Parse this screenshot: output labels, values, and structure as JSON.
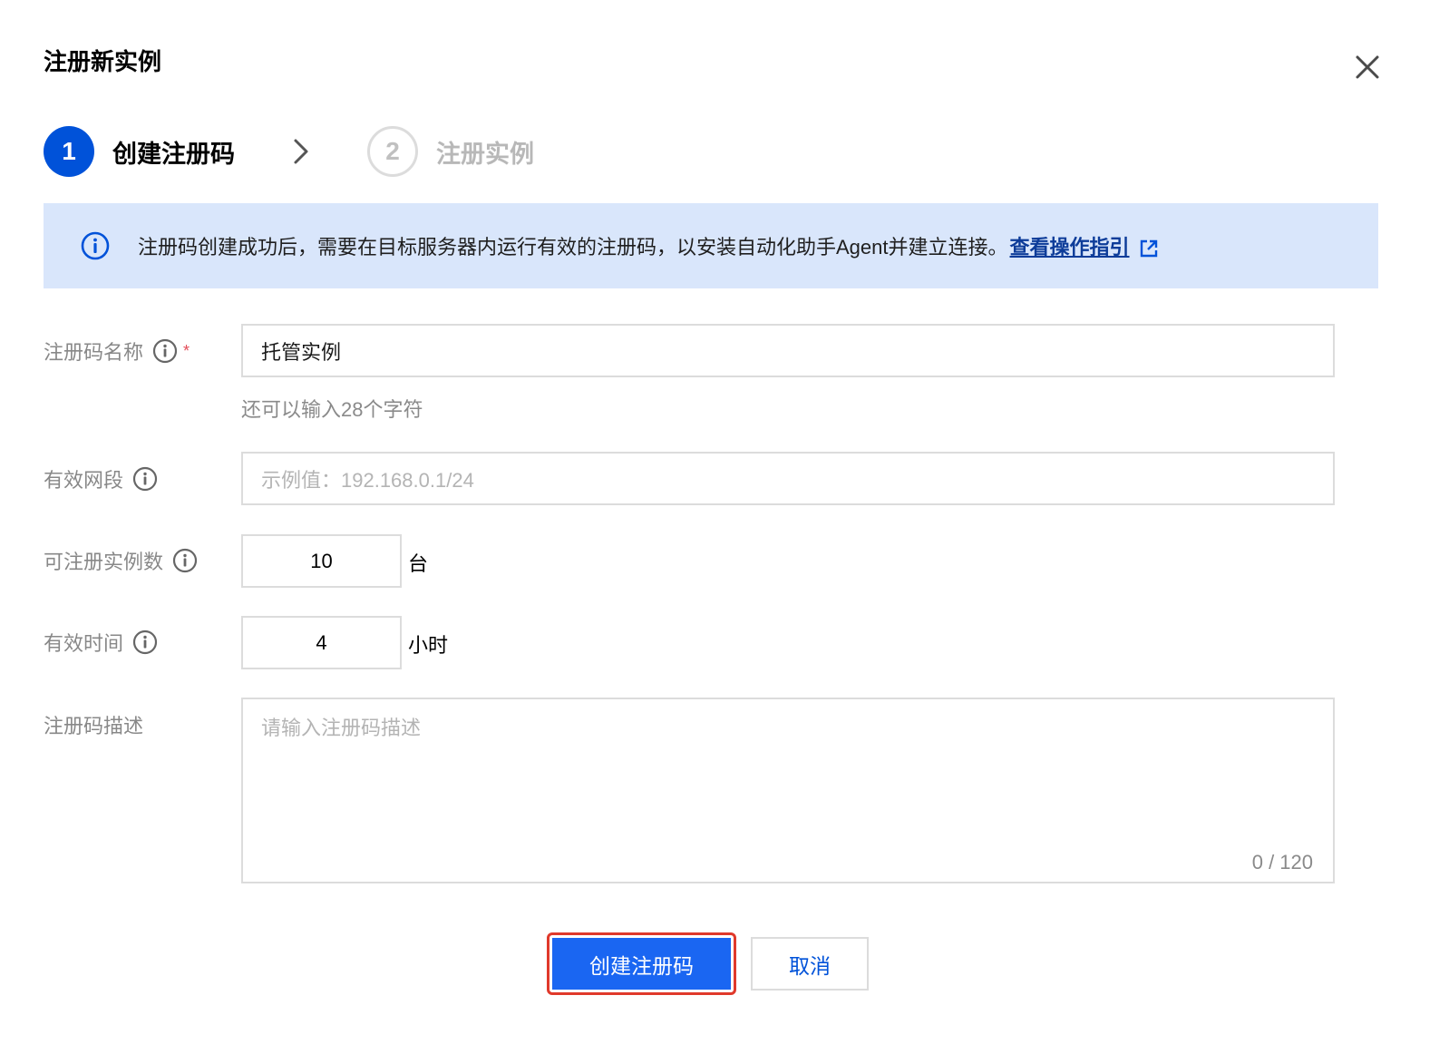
{
  "dialog": {
    "title": "注册新实例"
  },
  "steps": [
    {
      "number": "1",
      "label": "创建注册码",
      "state": "active"
    },
    {
      "number": "2",
      "label": "注册实例",
      "state": "inactive"
    }
  ],
  "alert": {
    "text": "注册码创建成功后，需要在目标服务器内运行有效的注册码，以安装自动化助手Agent并建立连接。",
    "link_label": "查看操作指引"
  },
  "form": {
    "name": {
      "label": "注册码名称",
      "value": "托管实例",
      "hint": "还可以输入28个字符",
      "required_mark": "*"
    },
    "cidr": {
      "label": "有效网段",
      "placeholder": "示例值：192.168.0.1/24"
    },
    "count": {
      "label": "可注册实例数",
      "value": "10",
      "unit": "台"
    },
    "duration": {
      "label": "有效时间",
      "value": "4",
      "unit": "小时"
    },
    "description": {
      "label": "注册码描述",
      "placeholder": "请输入注册码描述",
      "counter": "0 / 120"
    }
  },
  "footer": {
    "confirm_label": "创建注册码",
    "cancel_label": "取消"
  },
  "colors": {
    "primary": "#0052d9",
    "alert_bg": "#d9e6fb",
    "highlight_border": "#e0392b",
    "required": "#e34d59"
  }
}
